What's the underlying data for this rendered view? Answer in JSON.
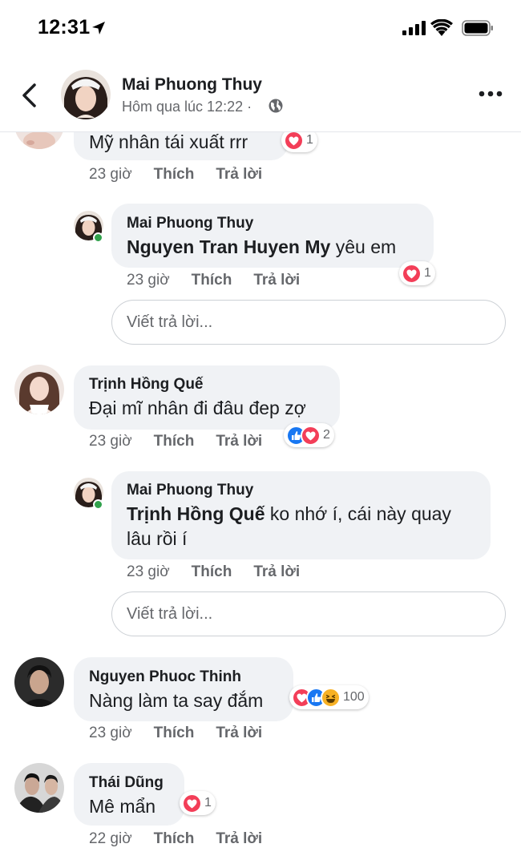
{
  "status_bar": {
    "time": "12:31"
  },
  "header": {
    "name": "Mai Phuong Thuy",
    "subtitle": "Hôm qua lúc 12:22 ·"
  },
  "labels": {
    "like": "Thích",
    "reply": "Trả lời",
    "write_reply_placeholder": "Viết trả lời..."
  },
  "comments": [
    {
      "text": "Mỹ nhân tái xuất rrr",
      "time": "23 giờ",
      "reactions": {
        "types": [
          "heart"
        ],
        "count": "1"
      }
    },
    {
      "author": "Mai Phuong Thuy",
      "mention": "Nguyen Tran Huyen My",
      "text": " yêu em",
      "time": "23 giờ",
      "reactions": {
        "types": [
          "heart"
        ],
        "count": "1"
      }
    },
    {
      "author": "Trịnh Hồng Quế",
      "text": "Đại mĩ nhân đi đâu đep zợ",
      "time": "23 giờ",
      "reactions": {
        "types": [
          "like",
          "heart"
        ],
        "count": "2"
      }
    },
    {
      "author": "Mai Phuong Thuy",
      "mention": "Trịnh Hồng Quế",
      "text": " ko nhớ í, cái này quay",
      "text2": "lâu rồi í",
      "time": "23 giờ"
    },
    {
      "author": "Nguyen Phuoc Thinh",
      "text": "Nàng làm ta say đắm",
      "time": "23 giờ",
      "reactions": {
        "types": [
          "heart",
          "like",
          "haha"
        ],
        "count": "100"
      }
    },
    {
      "author": "Thái Dũng",
      "text": "Mê mẩn",
      "time": "22 giờ",
      "reactions": {
        "types": [
          "heart"
        ],
        "count": "1"
      }
    }
  ],
  "colors": {
    "like": "#1877f2",
    "heart": "#f33e58",
    "haha": "#f7b125",
    "online": "#31a24c",
    "bubble": "#f0f2f5"
  }
}
